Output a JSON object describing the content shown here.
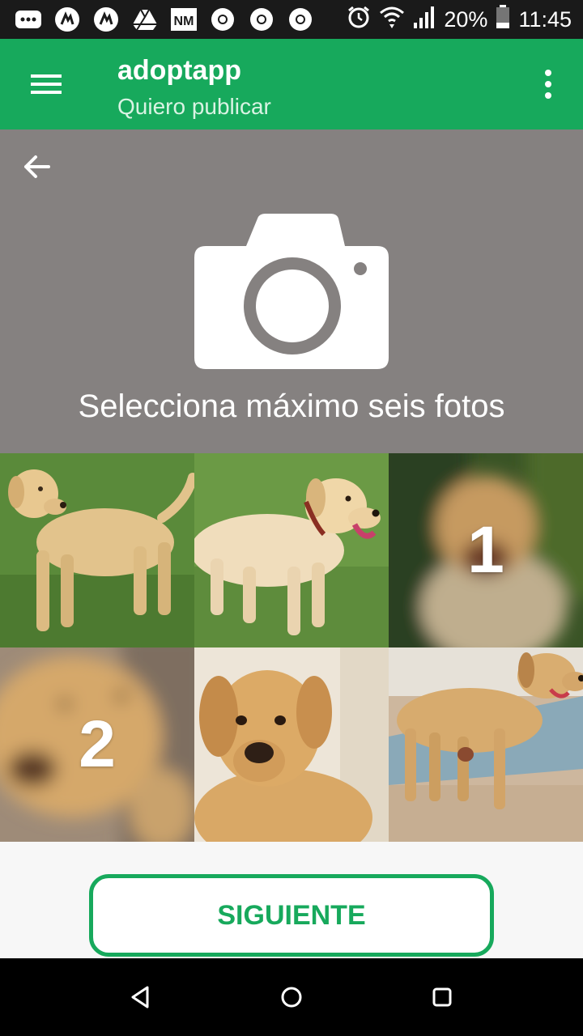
{
  "status_bar": {
    "left_icons": [
      "more-notifications-icon",
      "music-app-icon",
      "music-app-icon",
      "drive-icon",
      "nm-app-icon",
      "chrome-icon",
      "chrome-icon",
      "chrome-icon"
    ],
    "battery": "20%",
    "time": "11:45"
  },
  "app_bar": {
    "title": "adoptapp",
    "subtitle": "Quiero publicar"
  },
  "header": {
    "hint": "Selecciona máximo seis fotos"
  },
  "photos": [
    {
      "overlay": ""
    },
    {
      "overlay": ""
    },
    {
      "overlay": "1"
    },
    {
      "overlay": "2"
    },
    {
      "overlay": ""
    },
    {
      "overlay": ""
    }
  ],
  "actions": {
    "next_label": "SIGUIENTE"
  },
  "colors": {
    "primary": "#17a95c",
    "header_bg": "#858180"
  }
}
